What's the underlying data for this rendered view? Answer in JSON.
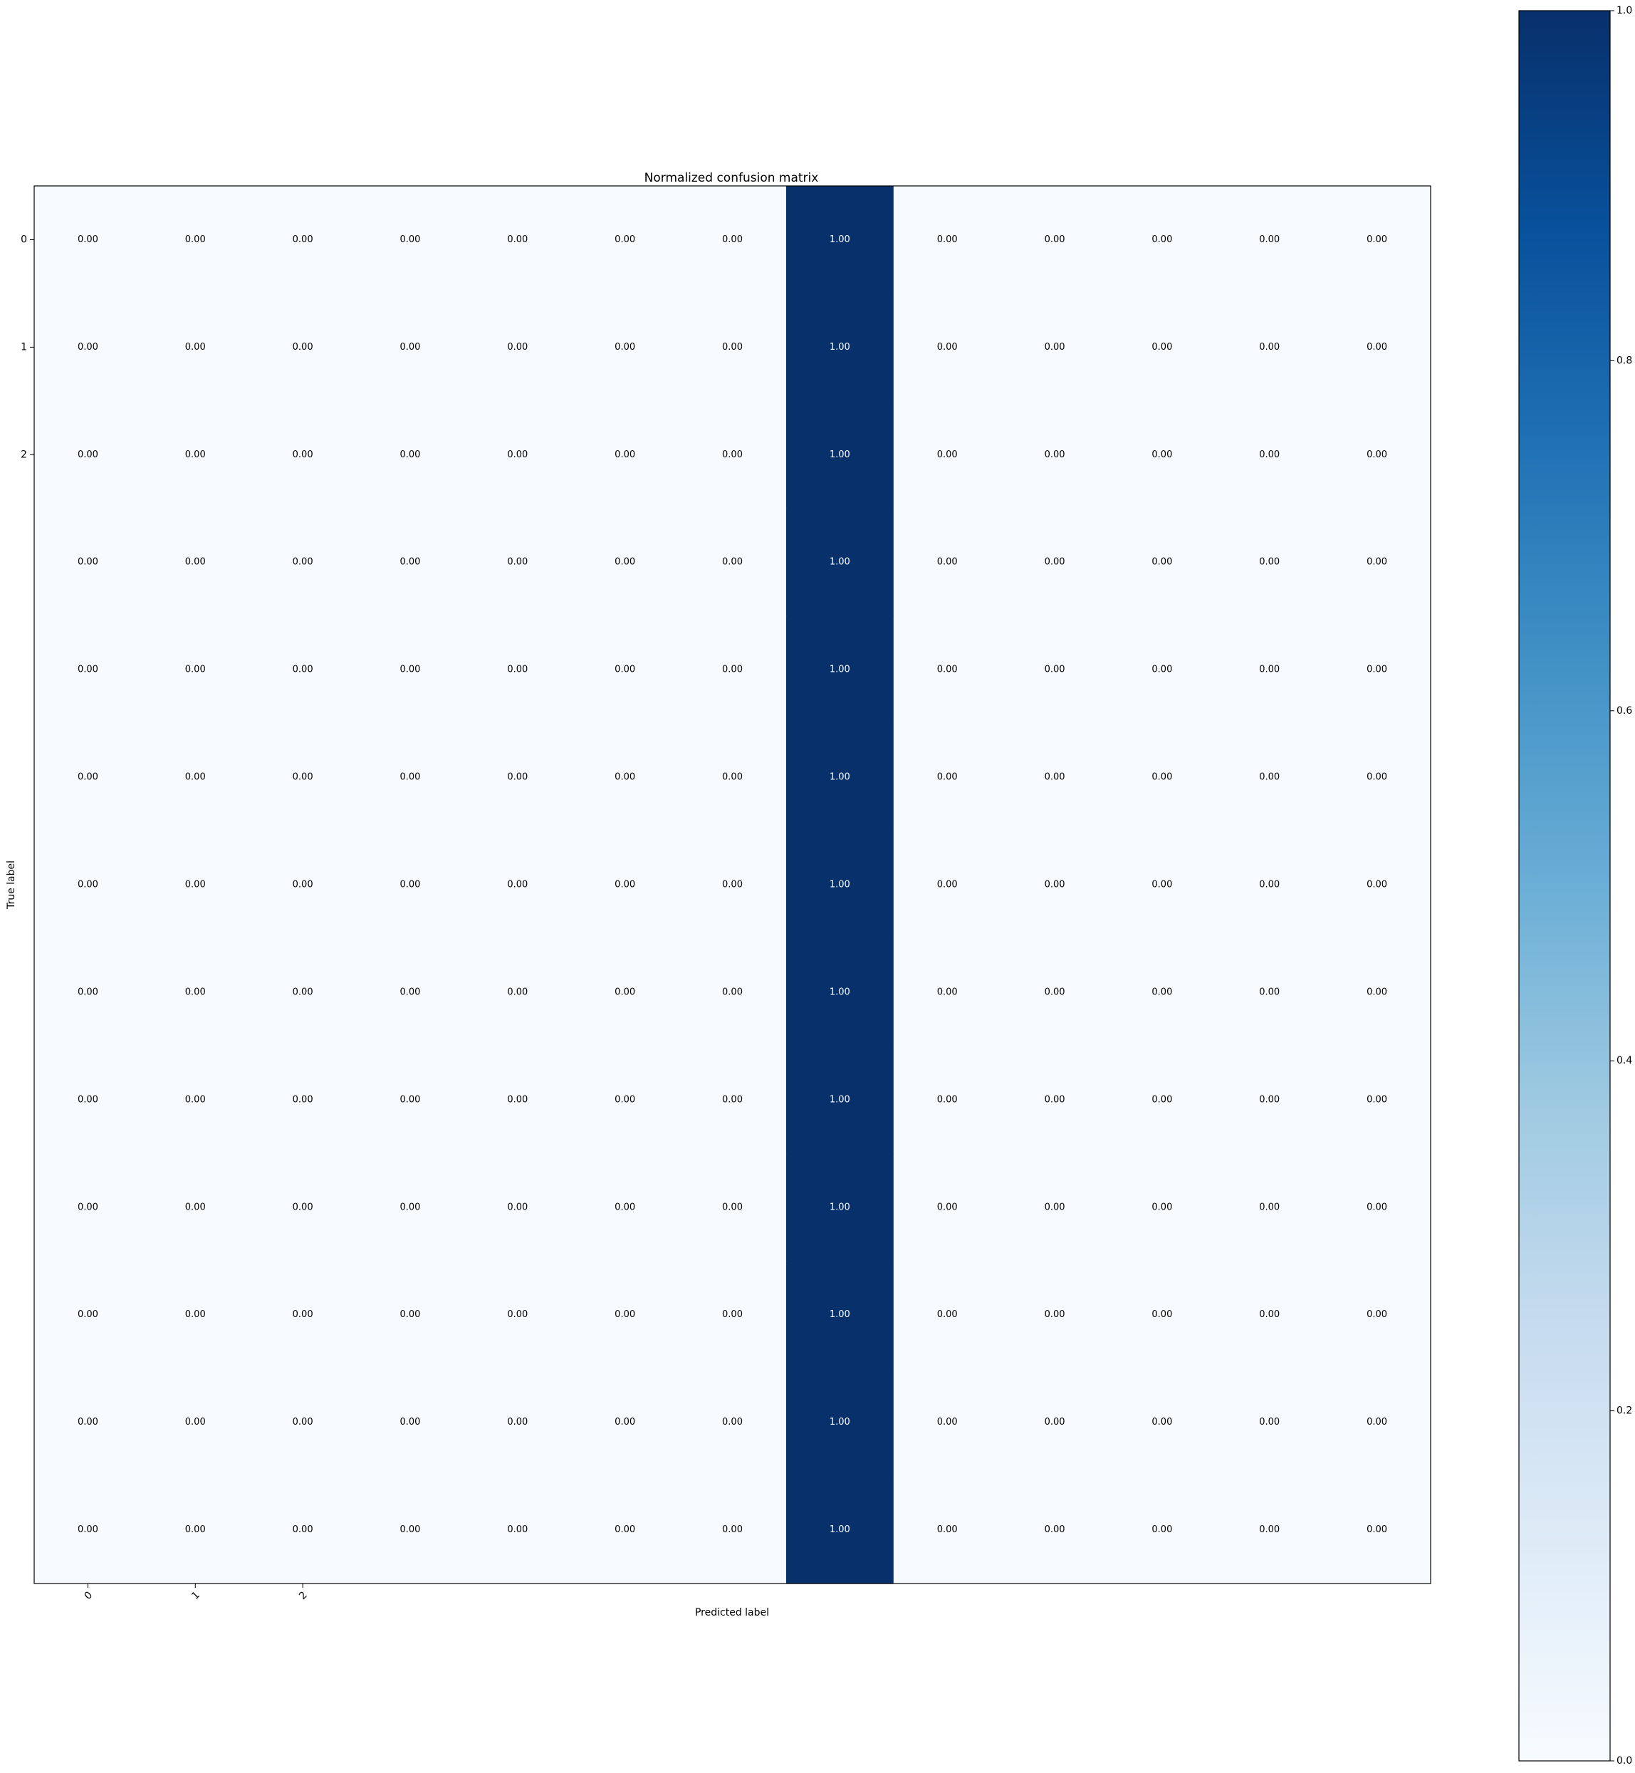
{
  "chart_data": {
    "type": "heatmap",
    "title": "Normalized confusion matrix",
    "xlabel": "Predicted label",
    "ylabel": "True label",
    "x_tick_labels": [
      "0",
      "1",
      "2"
    ],
    "y_tick_labels": [
      "0",
      "1",
      "2"
    ],
    "n_rows": 13,
    "n_cols": 13,
    "values": [
      [
        0,
        0,
        0,
        0,
        0,
        0,
        0,
        1,
        0,
        0,
        0,
        0,
        0
      ],
      [
        0,
        0,
        0,
        0,
        0,
        0,
        0,
        1,
        0,
        0,
        0,
        0,
        0
      ],
      [
        0,
        0,
        0,
        0,
        0,
        0,
        0,
        1,
        0,
        0,
        0,
        0,
        0
      ],
      [
        0,
        0,
        0,
        0,
        0,
        0,
        0,
        1,
        0,
        0,
        0,
        0,
        0
      ],
      [
        0,
        0,
        0,
        0,
        0,
        0,
        0,
        1,
        0,
        0,
        0,
        0,
        0
      ],
      [
        0,
        0,
        0,
        0,
        0,
        0,
        0,
        1,
        0,
        0,
        0,
        0,
        0
      ],
      [
        0,
        0,
        0,
        0,
        0,
        0,
        0,
        1,
        0,
        0,
        0,
        0,
        0
      ],
      [
        0,
        0,
        0,
        0,
        0,
        0,
        0,
        1,
        0,
        0,
        0,
        0,
        0
      ],
      [
        0,
        0,
        0,
        0,
        0,
        0,
        0,
        1,
        0,
        0,
        0,
        0,
        0
      ],
      [
        0,
        0,
        0,
        0,
        0,
        0,
        0,
        1,
        0,
        0,
        0,
        0,
        0
      ],
      [
        0,
        0,
        0,
        0,
        0,
        0,
        0,
        1,
        0,
        0,
        0,
        0,
        0
      ],
      [
        0,
        0,
        0,
        0,
        0,
        0,
        0,
        1,
        0,
        0,
        0,
        0,
        0
      ],
      [
        0,
        0,
        0,
        0,
        0,
        0,
        0,
        1,
        0,
        0,
        0,
        0,
        0
      ]
    ],
    "value_format": "0.00",
    "colormap": "Blues",
    "colors": {
      "low": "#f7fbff",
      "high": "#08306b"
    },
    "colorbar": {
      "range": [
        0.0,
        1.0
      ],
      "ticks": [
        "0.0",
        "0.2",
        "0.4",
        "0.6",
        "0.8",
        "1.0"
      ]
    },
    "grid": false
  }
}
